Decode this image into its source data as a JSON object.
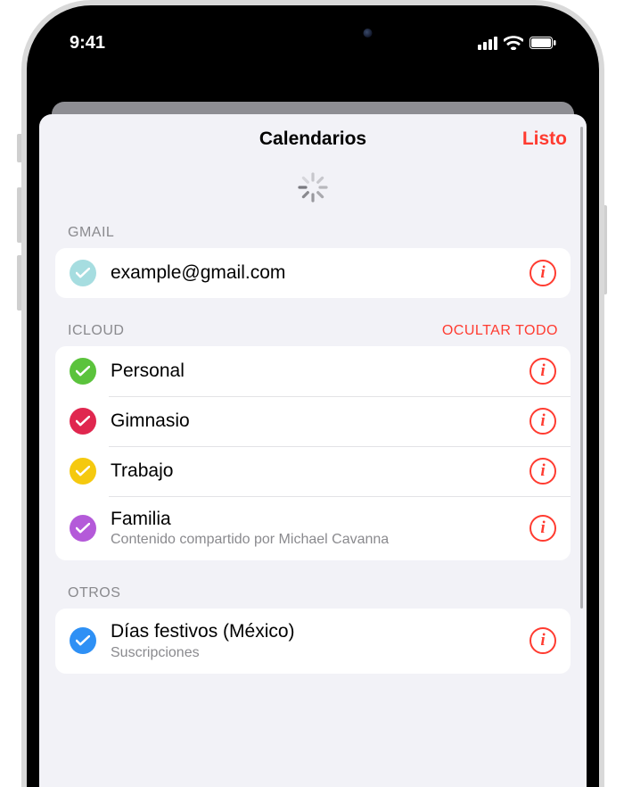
{
  "status": {
    "time": "9:41"
  },
  "sheet": {
    "title": "Calendarios",
    "done": "Listo"
  },
  "sections": {
    "gmail": {
      "label": "Gmail",
      "items": [
        {
          "title": "example@gmail.com",
          "color": "#a6dde0",
          "tick": "#ffffff"
        }
      ]
    },
    "icloud": {
      "label": "iCloud",
      "action": "Ocultar todo",
      "items": [
        {
          "title": "Personal",
          "color": "#5bc33c",
          "tick": "#ffffff"
        },
        {
          "title": "Gimnasio",
          "color": "#e0274f",
          "tick": "#ffffff"
        },
        {
          "title": "Trabajo",
          "color": "#f5c90f",
          "tick": "#ffffff"
        },
        {
          "title": "Familia",
          "subtitle": "Contenido compartido por Michael Cavanna",
          "color": "#b45ad9",
          "tick": "#ffffff"
        }
      ]
    },
    "others": {
      "label": "Otros",
      "items": [
        {
          "title": "Días festivos (México)",
          "subtitle": "Suscripciones",
          "color": "#2e90f5",
          "tick": "#ffffff"
        }
      ]
    }
  },
  "icons": {
    "info_glyph": "i"
  }
}
